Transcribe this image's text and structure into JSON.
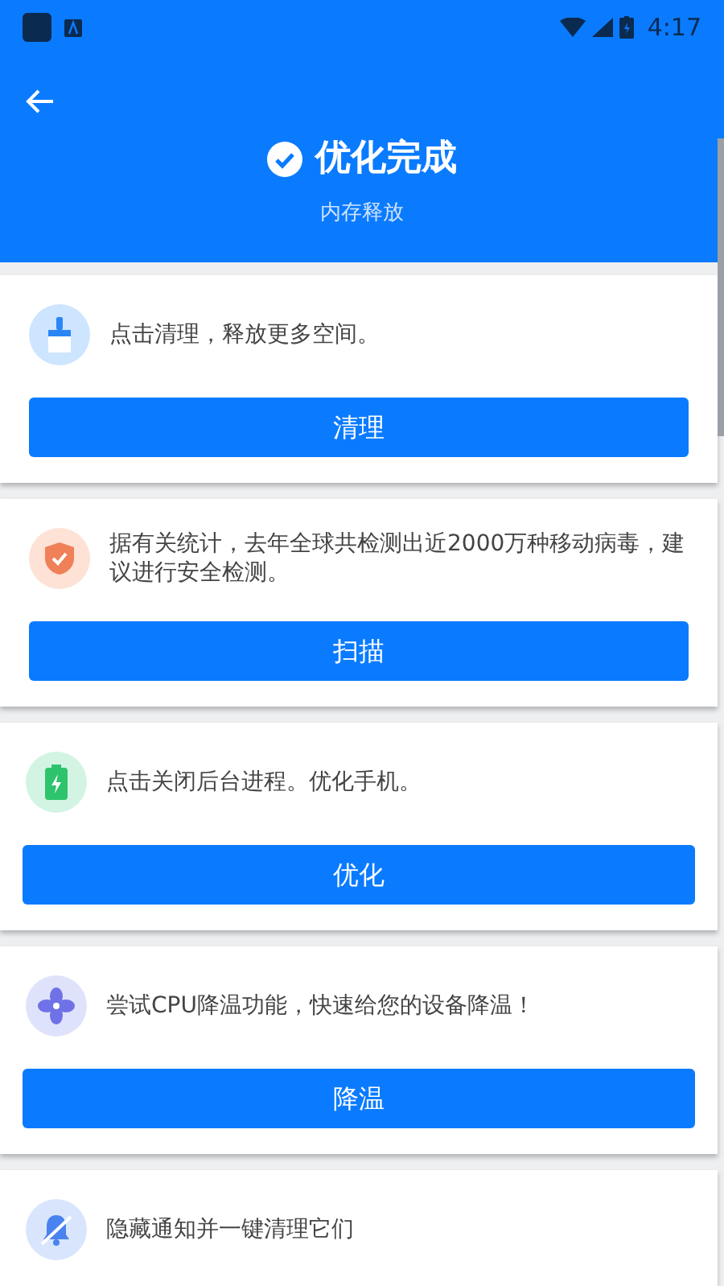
{
  "status_bar": {
    "time": "4:17"
  },
  "header": {
    "title": "优化完成",
    "subtitle": "内存释放"
  },
  "cards": [
    {
      "text": "点击清理，释放更多空间。",
      "button": "清理"
    },
    {
      "text": "据有关统计，去年全球共检测出近2000万种移动病毒，建议进行安全检测。",
      "button": "扫描"
    },
    {
      "text": "点击关闭后台进程。优化手机。",
      "button": "优化"
    },
    {
      "text": "尝试CPU降温功能，快速给您的设备降温！",
      "button": "降温"
    },
    {
      "text": "隐藏通知并一键清理它们"
    }
  ]
}
